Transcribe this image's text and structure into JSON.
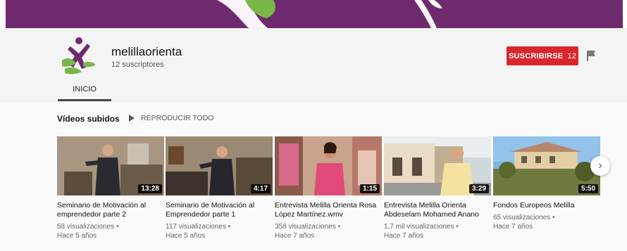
{
  "channel": {
    "name": "melillaorienta",
    "subscribers_text": "12 suscriptores",
    "logo_icon": "melillaorienta-logo-icon"
  },
  "actions": {
    "subscribe_label": "SUSCRIBIRSE",
    "subscribe_count": "12",
    "flag_icon": "flag-icon"
  },
  "tabs": [
    {
      "label": "INICIO",
      "active": true
    }
  ],
  "uploads": {
    "title": "Vídeos subidos",
    "play_all_label": "REPRODUCIR TODO",
    "play_icon": "play-icon",
    "videos": [
      {
        "title": "Seminario de Motivación al emprendedor parte 2",
        "duration": "13:28",
        "views": "58 visualizaciones",
        "age": "Hace 5 años"
      },
      {
        "title": "Seminario de Motivación al Emprendedor parte 1",
        "duration": "4:17",
        "views": "117 visualizaciones",
        "age": "Hace 5 años"
      },
      {
        "title": "Entrevista Melilla Orienta Rosa López Martínez.wmv",
        "duration": "1:15",
        "views": "358 visualizaciones",
        "age": "Hace 7 años"
      },
      {
        "title": "Entrevista Melilla Orienta Abdeselam Mohamed Anano",
        "duration": "3:29",
        "views": "1,7 mil visualizaciones",
        "age": "Hace 7 años"
      },
      {
        "title": "Fondos Europeos Melilla",
        "duration": "5:50",
        "views": "65 visualizaciones",
        "age": "Hace 7 años"
      }
    ],
    "meta_separator": "•",
    "next_icon": "chevron-right-icon",
    "next_glyph": "›"
  },
  "colors": {
    "banner": "#6e2a6c",
    "brand_green": "#7ab648",
    "subscribe_red": "#d9262c"
  }
}
